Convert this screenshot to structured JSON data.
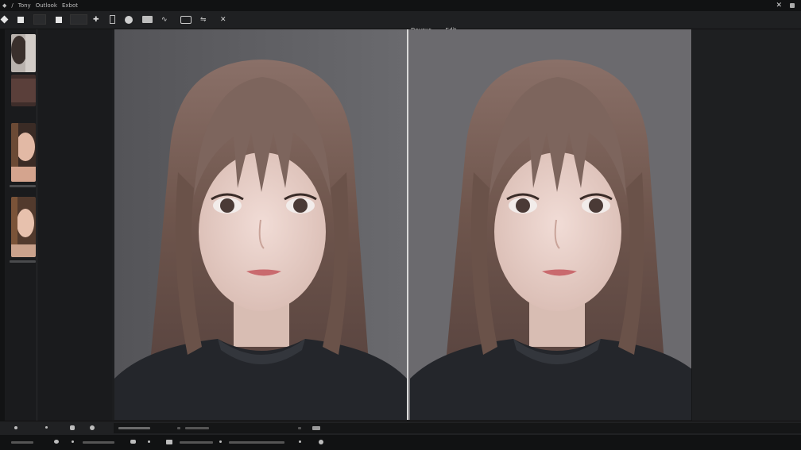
{
  "menu": {
    "items": [
      "Tony",
      "Outlook",
      "Exbot"
    ]
  },
  "tabs": [
    "Devour",
    "Edit"
  ],
  "icons": {
    "select": "arrow-icon",
    "crop": "crop-icon",
    "move": "plus-icon",
    "frame": "frame-icon",
    "brush": "circle-icon",
    "layers": "folder-icon",
    "lasso": "wave-icon",
    "display": "display-icon",
    "compare": "compare-icon",
    "adjust": "wrench-icon",
    "close": "close-icon"
  },
  "colors": {
    "bg": "#1c1d1f",
    "canvas": "#606064",
    "accent": "#d9d9d9"
  }
}
